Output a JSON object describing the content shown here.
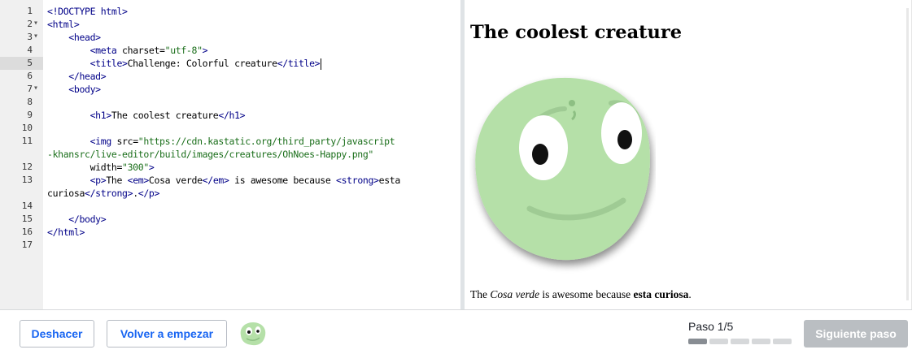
{
  "editor": {
    "line_numbers": [
      "1",
      "2",
      "3",
      "4",
      "5",
      "6",
      "7",
      "8",
      "9",
      "10",
      "11",
      "",
      "12",
      "13",
      "",
      "14",
      "15",
      "16",
      "17"
    ],
    "fold_marker": "▾",
    "code_lines": [
      {
        "parts": [
          [
            "t",
            "<!DOCTYPE html>"
          ]
        ]
      },
      {
        "parts": [
          [
            "t",
            "<html>"
          ]
        ]
      },
      {
        "parts": [
          [
            "a",
            "    "
          ],
          [
            "t",
            "<head>"
          ]
        ]
      },
      {
        "parts": [
          [
            "a",
            "        "
          ],
          [
            "t",
            "<meta "
          ],
          [
            "a",
            "charset="
          ],
          [
            "s",
            "\"utf-8\""
          ],
          [
            "t",
            ">"
          ]
        ]
      },
      {
        "parts": [
          [
            "a",
            "        "
          ],
          [
            "t",
            "<title>"
          ],
          [
            "a",
            "Challenge: Colorful creature"
          ],
          [
            "t",
            "</title>"
          ]
        ]
      },
      {
        "parts": [
          [
            "a",
            "    "
          ],
          [
            "t",
            "</head>"
          ]
        ]
      },
      {
        "parts": [
          [
            "a",
            "    "
          ],
          [
            "t",
            "<body>"
          ]
        ]
      },
      {
        "parts": [
          [
            "a",
            ""
          ]
        ]
      },
      {
        "parts": [
          [
            "a",
            "        "
          ],
          [
            "t",
            "<h1>"
          ],
          [
            "a",
            "The coolest creature"
          ],
          [
            "t",
            "</h1>"
          ]
        ]
      },
      {
        "parts": [
          [
            "a",
            ""
          ]
        ]
      },
      {
        "parts": [
          [
            "a",
            "        "
          ],
          [
            "t",
            "<img "
          ],
          [
            "a",
            "src="
          ],
          [
            "s",
            "\"https://cdn.kastatic.org/third_party/javascript"
          ]
        ]
      },
      {
        "parts": [
          [
            "s",
            "-khansrc/live-editor/build/images/creatures/OhNoes-Happy.png\""
          ]
        ]
      },
      {
        "parts": [
          [
            "a",
            "        width="
          ],
          [
            "s",
            "\"300\""
          ],
          [
            "t",
            ">"
          ]
        ]
      },
      {
        "parts": [
          [
            "a",
            "        "
          ],
          [
            "t",
            "<p>"
          ],
          [
            "a",
            "The "
          ],
          [
            "t",
            "<em>"
          ],
          [
            "a",
            "Cosa verde"
          ],
          [
            "t",
            "</em>"
          ],
          [
            "a",
            " is awesome because "
          ],
          [
            "t",
            "<strong>"
          ],
          [
            "a",
            "esta"
          ]
        ]
      },
      {
        "parts": [
          [
            "a",
            "curiosa"
          ],
          [
            "t",
            "</strong>"
          ],
          [
            "a",
            "."
          ],
          [
            "t",
            "</p>"
          ]
        ]
      },
      {
        "parts": [
          [
            "a",
            ""
          ]
        ]
      },
      {
        "parts": [
          [
            "a",
            "    "
          ],
          [
            "t",
            "</body>"
          ]
        ]
      },
      {
        "parts": [
          [
            "t",
            "</html>"
          ]
        ]
      },
      {
        "parts": [
          [
            "a",
            ""
          ]
        ]
      }
    ]
  },
  "preview": {
    "heading": "The coolest creature",
    "para_pre": "The ",
    "para_em": "Cosa verde",
    "para_mid": " is awesome because ",
    "para_strong": "esta curiosa",
    "para_post": "."
  },
  "footer": {
    "undo_label": "Deshacer",
    "restart_label": "Volver a empezar",
    "step_label": "Paso 1/5",
    "steps_total": 5,
    "steps_done": 1,
    "next_label": "Siguiente paso"
  },
  "colors": {
    "creature_green": "#b5e0a8",
    "accent_blue": "#1865f2",
    "disabled_gray": "#babec2"
  }
}
